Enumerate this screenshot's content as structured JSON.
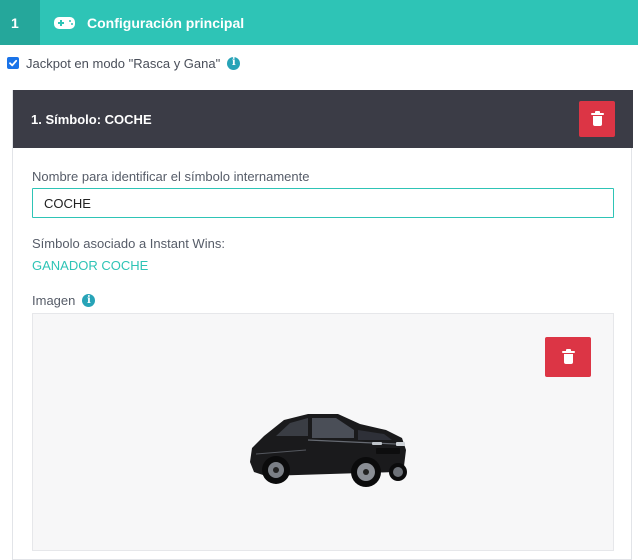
{
  "topbar": {
    "step_number": "1",
    "icon": "gamepad-icon",
    "title": "Configuración principal",
    "color": "#2ec4b6"
  },
  "jackpot": {
    "checked": true,
    "label": "Jackpot en modo \"Rasca y Gana\""
  },
  "symbol": {
    "header_title": "1. Símbolo: COCHE",
    "name_label": "Nombre para identificar el símbolo internamente",
    "name_value": "COCHE",
    "instant_wins_label": "Símbolo asociado a Instant Wins:",
    "instant_wins_value": "GANADOR COCHE",
    "image_label": "Imagen",
    "image_icon": "car-image"
  },
  "colors": {
    "accent": "#2ec4b6",
    "header_dark": "#3b3c46",
    "danger": "#dc3545",
    "info": "#27a3b7"
  }
}
